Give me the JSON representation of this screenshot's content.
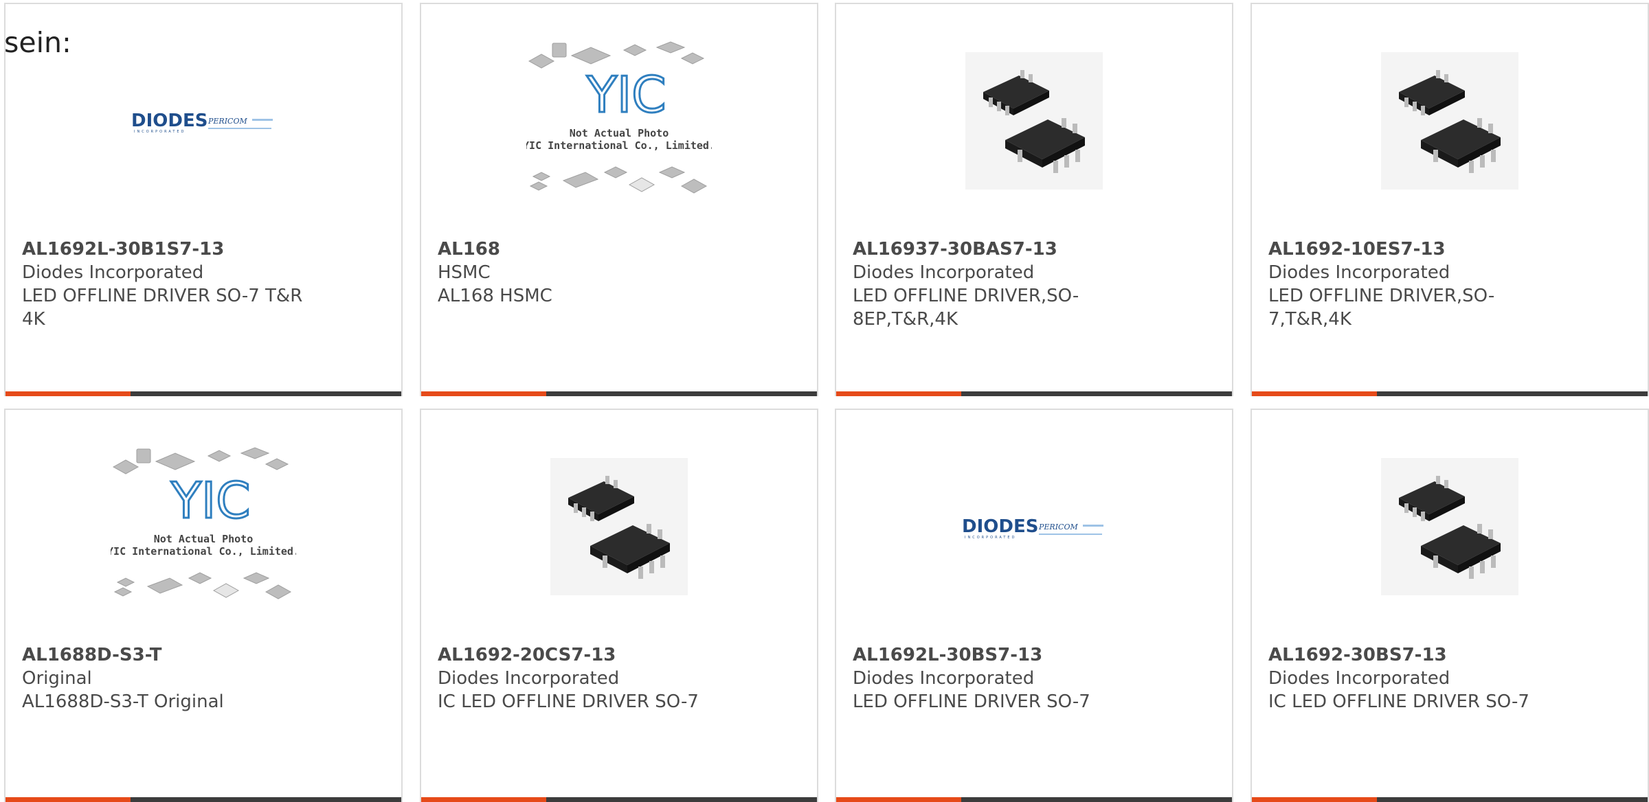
{
  "intro_text": "sein:",
  "colors": {
    "accent": "#e64a19",
    "bar": "#3c3c3c",
    "border": "#dcdcdc",
    "text": "#4a4a4a"
  },
  "products": [
    {
      "part_number": "AL1692L-30B1S7-13",
      "manufacturer": "Diodes Incorporated",
      "description": "LED OFFLINE DRIVER SO-7 T&R 4K",
      "image": "diodes-pericom-logo"
    },
    {
      "part_number": "AL168",
      "manufacturer": "HSMC",
      "description": "AL168 HSMC",
      "image": "yic-placeholder"
    },
    {
      "part_number": "AL16937-30BAS7-13",
      "manufacturer": "Diodes Incorporated",
      "description": "LED OFFLINE DRIVER,SO-8EP,T&R,4K",
      "image": "soic-chip-photo"
    },
    {
      "part_number": "AL1692-10ES7-13",
      "manufacturer": "Diodes Incorporated",
      "description": "LED OFFLINE DRIVER,SO-7,T&R,4K",
      "image": "soic-chip-photo"
    },
    {
      "part_number": "AL1688D-S3-T",
      "manufacturer": "Original",
      "description": "AL1688D-S3-T Original",
      "image": "yic-placeholder"
    },
    {
      "part_number": "AL1692-20CS7-13",
      "manufacturer": "Diodes Incorporated",
      "description": "IC LED OFFLINE DRIVER SO-7",
      "image": "soic-chip-photo"
    },
    {
      "part_number": "AL1692L-30BS7-13",
      "manufacturer": "Diodes Incorporated",
      "description": "LED OFFLINE DRIVER SO-7",
      "image": "diodes-pericom-logo"
    },
    {
      "part_number": "AL1692-30BS7-13",
      "manufacturer": "Diodes Incorporated",
      "description": "IC LED OFFLINE DRIVER SO-7",
      "image": "soic-chip-photo"
    }
  ],
  "logo_text": {
    "diodes": "DIODES",
    "diodes_sub": "INCORPORATED",
    "pericom": "PERICOM",
    "yic": "YIC",
    "yic_note_1": "Not Actual Photo",
    "yic_note_2": "YIC International Co., Limited."
  }
}
